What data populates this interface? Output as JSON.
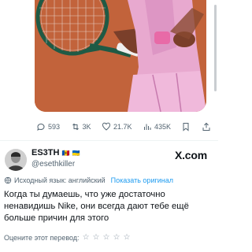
{
  "post": {
    "stats": {
      "replies": "593",
      "reposts": "3K",
      "likes": "21.7K",
      "views": "435K"
    }
  },
  "tweet": {
    "author_name": "ES3TH",
    "author_flags": [
      "🇲🇩",
      "🇺🇦"
    ],
    "handle": "@esethkiller",
    "logo_text": "X.com",
    "translation_note": "Исходный язык: английский",
    "show_original_label": "Показать оригинал",
    "text": "Когда ты думаешь, что уже достаточно ненавидишь Nike, они всегда дают тебе ещё больше причин для этого",
    "rate_translation_label": "Оцените этот перевод:",
    "rating_stars": 5
  },
  "colors": {
    "accent": "#1d9bf0",
    "muted": "#536471",
    "text": "#0f1419"
  }
}
